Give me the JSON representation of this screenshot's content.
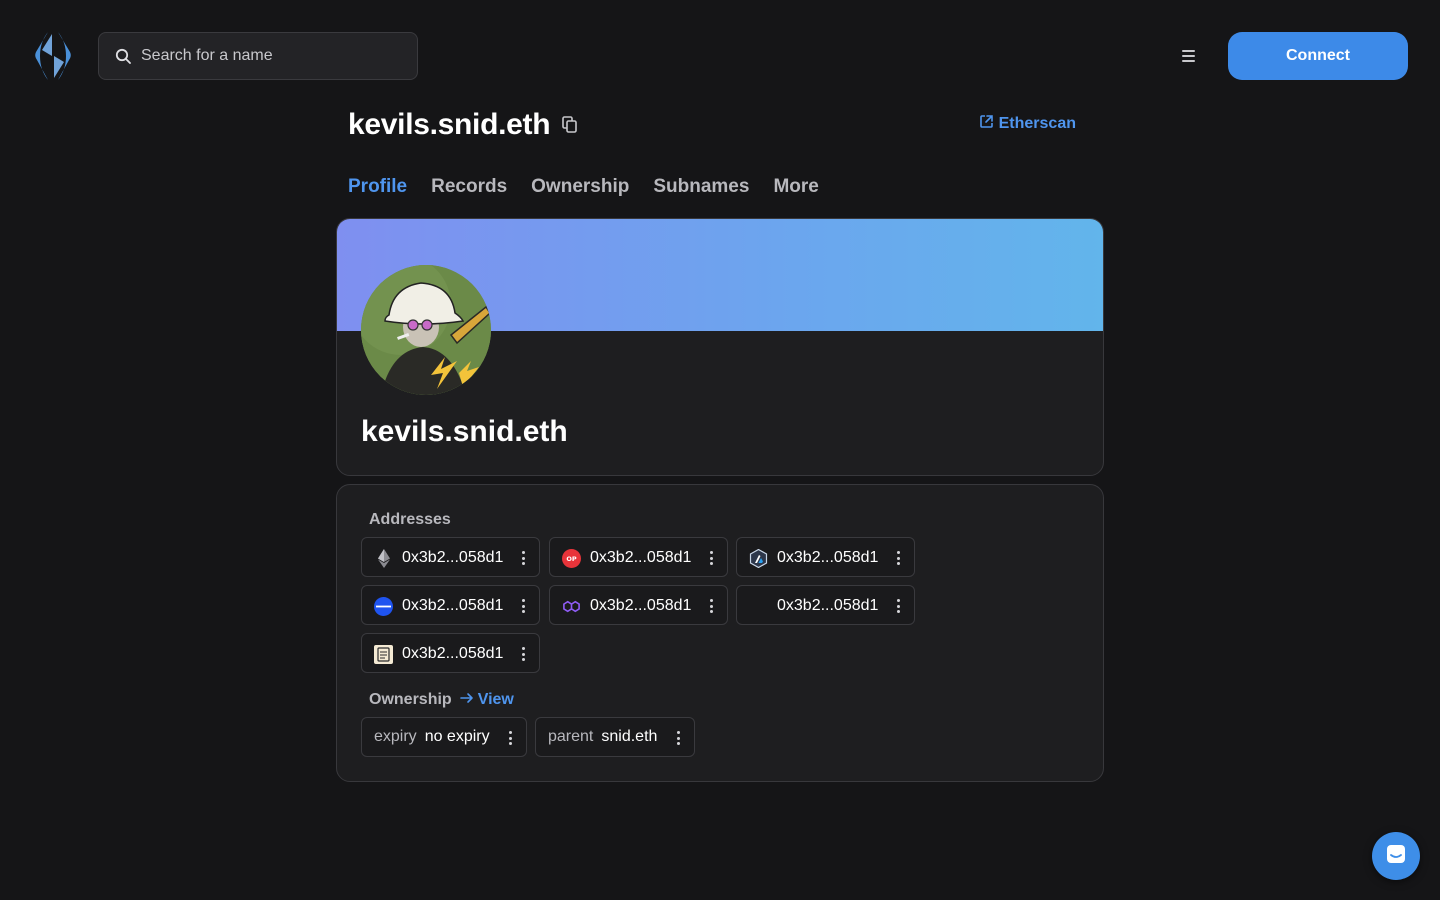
{
  "header": {
    "search_placeholder": "Search for a name",
    "connect_label": "Connect"
  },
  "name_header": {
    "title": "kevils.snid.eth",
    "etherscan_label": "Etherscan"
  },
  "tabs": [
    {
      "label": "Profile",
      "active": true
    },
    {
      "label": "Records",
      "active": false
    },
    {
      "label": "Ownership",
      "active": false
    },
    {
      "label": "Subnames",
      "active": false
    },
    {
      "label": "More",
      "active": false
    }
  ],
  "profile": {
    "name": "kevils.snid.eth"
  },
  "records": {
    "addresses_label": "Addresses",
    "addresses": [
      {
        "coin": "eth-icon",
        "value": "0x3b2...058d1"
      },
      {
        "coin": "optimism-icon",
        "value": "0x3b2...058d1"
      },
      {
        "coin": "arbitrum-icon",
        "value": "0x3b2...058d1"
      },
      {
        "coin": "base-icon",
        "value": "0x3b2...058d1"
      },
      {
        "coin": "polygon-icon",
        "value": "0x3b2...058d1"
      },
      {
        "coin": "blank-coin-icon",
        "value": "0x3b2...058d1"
      },
      {
        "coin": "scroll-icon",
        "value": "0x3b2...058d1"
      }
    ],
    "ownership_label": "Ownership",
    "view_label": "View",
    "ownership": [
      {
        "key": "expiry",
        "value": "no expiry"
      },
      {
        "key": "parent",
        "value": "snid.eth"
      }
    ]
  },
  "colors": {
    "accent": "#3d8ae8",
    "link": "#4f95ee",
    "background": "#151517",
    "card": "#1e1e20"
  }
}
